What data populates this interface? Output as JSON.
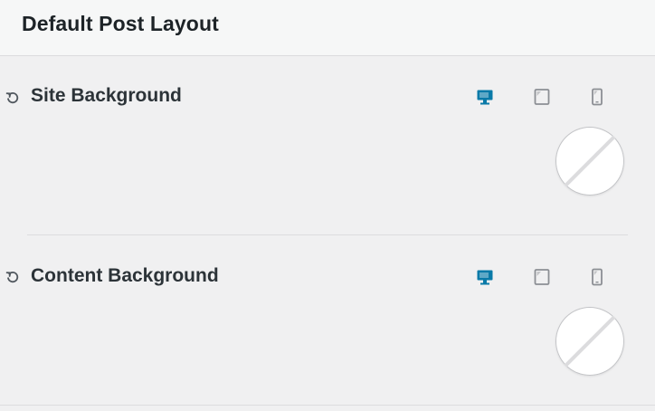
{
  "panel": {
    "title": "Default Post Layout"
  },
  "sections": [
    {
      "label": "Site Background",
      "devices": [
        "desktop-icon",
        "tablet-icon",
        "mobile-icon"
      ],
      "active_device": "desktop",
      "swatch_value": "none"
    },
    {
      "label": "Content Background",
      "devices": [
        "desktop-icon",
        "tablet-icon",
        "mobile-icon"
      ],
      "active_device": "desktop",
      "swatch_value": "none"
    }
  ],
  "colors": {
    "accent": "#0a7aa8",
    "inactive_icon": "#8c8f94",
    "panel_bg": "#f0f0f1",
    "header_bg": "#f6f7f7"
  }
}
